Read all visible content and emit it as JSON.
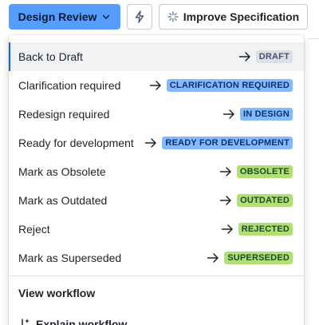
{
  "toolbar": {
    "status_label": "Design Review",
    "status_color": "#579dff",
    "action_icon": "lightning-icon",
    "improve_label": "Improve Specification",
    "improve_icon": "sparkle-icon"
  },
  "menu": {
    "items": [
      {
        "label": "Back to Draft",
        "status": "DRAFT",
        "lozenge_bg": "#dcdfe4",
        "lozenge_fg": "#44546f",
        "selected": true
      },
      {
        "label": "Clarification required",
        "status": "CLARIFICATION REQUIRED",
        "lozenge_bg": "#85b8ff",
        "lozenge_fg": "#09326c"
      },
      {
        "label": "Redesign required",
        "status": "IN DESIGN",
        "lozenge_bg": "#85b8ff",
        "lozenge_fg": "#09326c"
      },
      {
        "label": "Ready for development",
        "status": "READY FOR DEVELOPMENT",
        "lozenge_bg": "#85b8ff",
        "lozenge_fg": "#09326c"
      },
      {
        "label": "Mark as Obsolete",
        "status": "OBSOLETE",
        "lozenge_bg": "#b3df72",
        "lozenge_fg": "#164b35"
      },
      {
        "label": "Mark as Outdated",
        "status": "OUTDATED",
        "lozenge_bg": "#b3df72",
        "lozenge_fg": "#164b35"
      },
      {
        "label": "Reject",
        "status": "REJECTED",
        "lozenge_bg": "#b3df72",
        "lozenge_fg": "#164b35"
      },
      {
        "label": "Mark as Superseded",
        "status": "SUPERSEDED",
        "lozenge_bg": "#b3df72",
        "lozenge_fg": "#164b35"
      }
    ],
    "view_workflow_label": "View workflow",
    "explain_workflow_label": "Explain workflow",
    "explain_icon": "ai-sparkle-icon"
  }
}
